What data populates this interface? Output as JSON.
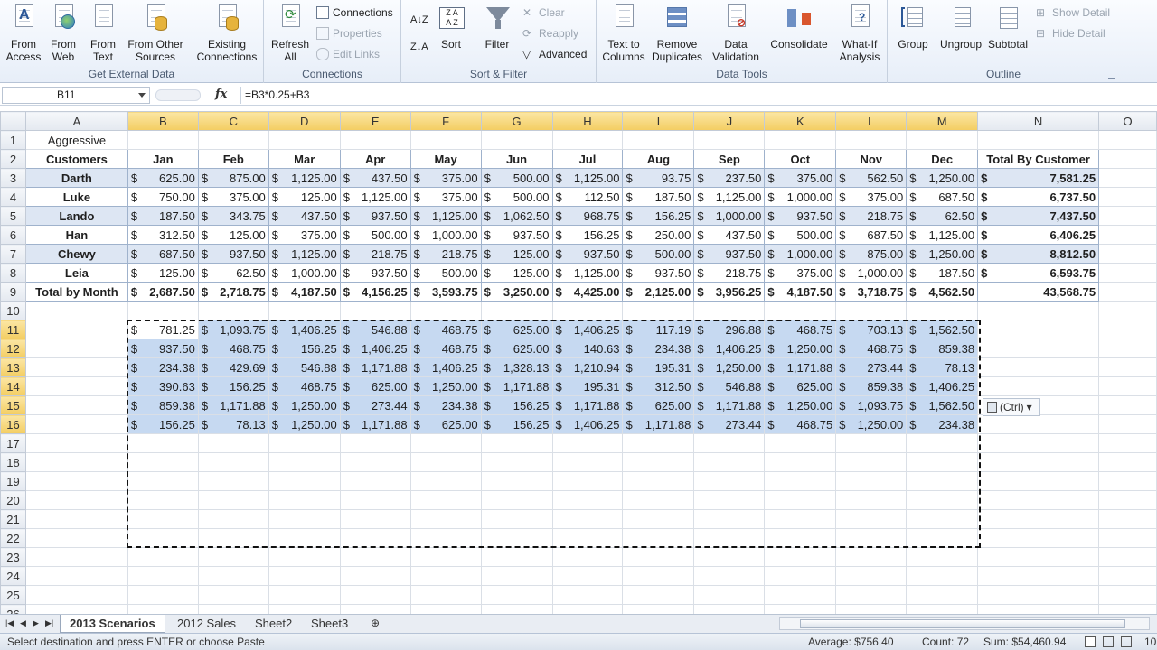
{
  "ribbon": {
    "get_external_data": {
      "label": "Get External Data",
      "from_access": "From Access",
      "from_web": "From Web",
      "from_text": "From Text",
      "from_other_sources": "From Other Sources",
      "existing_connections": "Existing Connections"
    },
    "connections": {
      "label": "Connections",
      "refresh_all": "Refresh All",
      "connections": "Connections",
      "properties": "Properties",
      "edit_links": "Edit Links"
    },
    "sort_filter": {
      "label": "Sort & Filter",
      "sort": "Sort",
      "filter": "Filter",
      "clear": "Clear",
      "reapply": "Reapply",
      "advanced": "Advanced"
    },
    "data_tools": {
      "label": "Data Tools",
      "text_to_columns": "Text to Columns",
      "remove_duplicates": "Remove Duplicates",
      "data_validation": "Data Validation",
      "consolidate": "Consolidate",
      "what_if": "What-If Analysis"
    },
    "outline": {
      "label": "Outline",
      "group": "Group",
      "ungroup": "Ungroup",
      "subtotal": "Subtotal",
      "show_detail": "Show Detail",
      "hide_detail": "Hide Detail"
    }
  },
  "formula_bar": {
    "name_box": "B11",
    "fx": "fx",
    "formula": "=B3*0.25+B3"
  },
  "sheet": {
    "columns": [
      "A",
      "B",
      "C",
      "D",
      "E",
      "F",
      "G",
      "H",
      "I",
      "J",
      "K",
      "L",
      "M",
      "N",
      "O"
    ],
    "row_numbers": [
      "1",
      "2",
      "3",
      "4",
      "5",
      "6",
      "7",
      "8",
      "9",
      "10",
      "11",
      "12",
      "13",
      "14",
      "15",
      "16",
      "17",
      "18",
      "19",
      "20",
      "21",
      "22",
      "23",
      "24",
      "25",
      "26"
    ],
    "a1": "Aggressive",
    "header_row": [
      "Customers",
      "Jan",
      "Feb",
      "Mar",
      "Apr",
      "May",
      "Jun",
      "Jul",
      "Aug",
      "Sep",
      "Oct",
      "Nov",
      "Dec",
      "Total By Customer"
    ],
    "data_rows": [
      {
        "name": "Darth",
        "values": [
          "625.00",
          "875.00",
          "1,125.00",
          "437.50",
          "375.00",
          "500.00",
          "1,125.00",
          "93.75",
          "237.50",
          "375.00",
          "562.50",
          "1,250.00"
        ],
        "total": "7,581.25"
      },
      {
        "name": "Luke",
        "values": [
          "750.00",
          "375.00",
          "125.00",
          "1,125.00",
          "375.00",
          "500.00",
          "112.50",
          "187.50",
          "1,125.00",
          "1,000.00",
          "375.00",
          "687.50"
        ],
        "total": "6,737.50"
      },
      {
        "name": "Lando",
        "values": [
          "187.50",
          "343.75",
          "437.50",
          "937.50",
          "1,125.00",
          "1,062.50",
          "968.75",
          "156.25",
          "1,000.00",
          "937.50",
          "218.75",
          "62.50"
        ],
        "total": "7,437.50"
      },
      {
        "name": "Han",
        "values": [
          "312.50",
          "125.00",
          "375.00",
          "500.00",
          "1,000.00",
          "937.50",
          "156.25",
          "250.00",
          "437.50",
          "500.00",
          "687.50",
          "1,125.00"
        ],
        "total": "6,406.25"
      },
      {
        "name": "Chewy",
        "values": [
          "687.50",
          "937.50",
          "1,125.00",
          "218.75",
          "218.75",
          "125.00",
          "937.50",
          "500.00",
          "937.50",
          "1,000.00",
          "875.00",
          "1,250.00"
        ],
        "total": "8,812.50"
      },
      {
        "name": "Leia",
        "values": [
          "125.00",
          "62.50",
          "1,000.00",
          "937.50",
          "500.00",
          "125.00",
          "1,125.00",
          "937.50",
          "218.75",
          "375.00",
          "1,000.00",
          "187.50"
        ],
        "total": "6,593.75"
      }
    ],
    "total_row": {
      "label": "Total by Month",
      "values": [
        "2,687.50",
        "2,718.75",
        "4,187.50",
        "4,156.25",
        "3,593.75",
        "3,250.00",
        "4,425.00",
        "2,125.00",
        "3,956.25",
        "4,187.50",
        "3,718.75",
        "4,562.50"
      ],
      "total": "43,568.75"
    },
    "pasted_rows": [
      [
        "781.25",
        "1,093.75",
        "1,406.25",
        "546.88",
        "468.75",
        "625.00",
        "1,406.25",
        "117.19",
        "296.88",
        "468.75",
        "703.13",
        "1,562.50"
      ],
      [
        "937.50",
        "468.75",
        "156.25",
        "1,406.25",
        "468.75",
        "625.00",
        "140.63",
        "234.38",
        "1,406.25",
        "1,250.00",
        "468.75",
        "859.38"
      ],
      [
        "234.38",
        "429.69",
        "546.88",
        "1,171.88",
        "1,406.25",
        "1,328.13",
        "1,210.94",
        "195.31",
        "1,250.00",
        "1,171.88",
        "273.44",
        "78.13"
      ],
      [
        "390.63",
        "156.25",
        "468.75",
        "625.00",
        "1,250.00",
        "1,171.88",
        "195.31",
        "312.50",
        "546.88",
        "625.00",
        "859.38",
        "1,406.25"
      ],
      [
        "859.38",
        "1,171.88",
        "1,250.00",
        "273.44",
        "234.38",
        "156.25",
        "1,171.88",
        "625.00",
        "1,171.88",
        "1,250.00",
        "1,093.75",
        "1,562.50"
      ],
      [
        "156.25",
        "78.13",
        "1,250.00",
        "1,171.88",
        "625.00",
        "156.25",
        "1,406.25",
        "1,171.88",
        "273.44",
        "468.75",
        "1,250.00",
        "234.38"
      ]
    ],
    "currency_symbol": "$",
    "paste_options": "(Ctrl)"
  },
  "tabs": {
    "sheets": [
      "2013 Scenarios",
      "2012 Sales",
      "Sheet2",
      "Sheet3"
    ],
    "active": "2013 Scenarios"
  },
  "status": {
    "message": "Select destination and press ENTER or choose Paste",
    "average": "Average:  $756.40",
    "count": "Count: 72",
    "sum": "Sum:  $54,460.94",
    "zoom": "10"
  },
  "colors": {
    "selection": "#c6d9f1",
    "band": "#dde6f3",
    "header_selected": "#f3cd62"
  }
}
